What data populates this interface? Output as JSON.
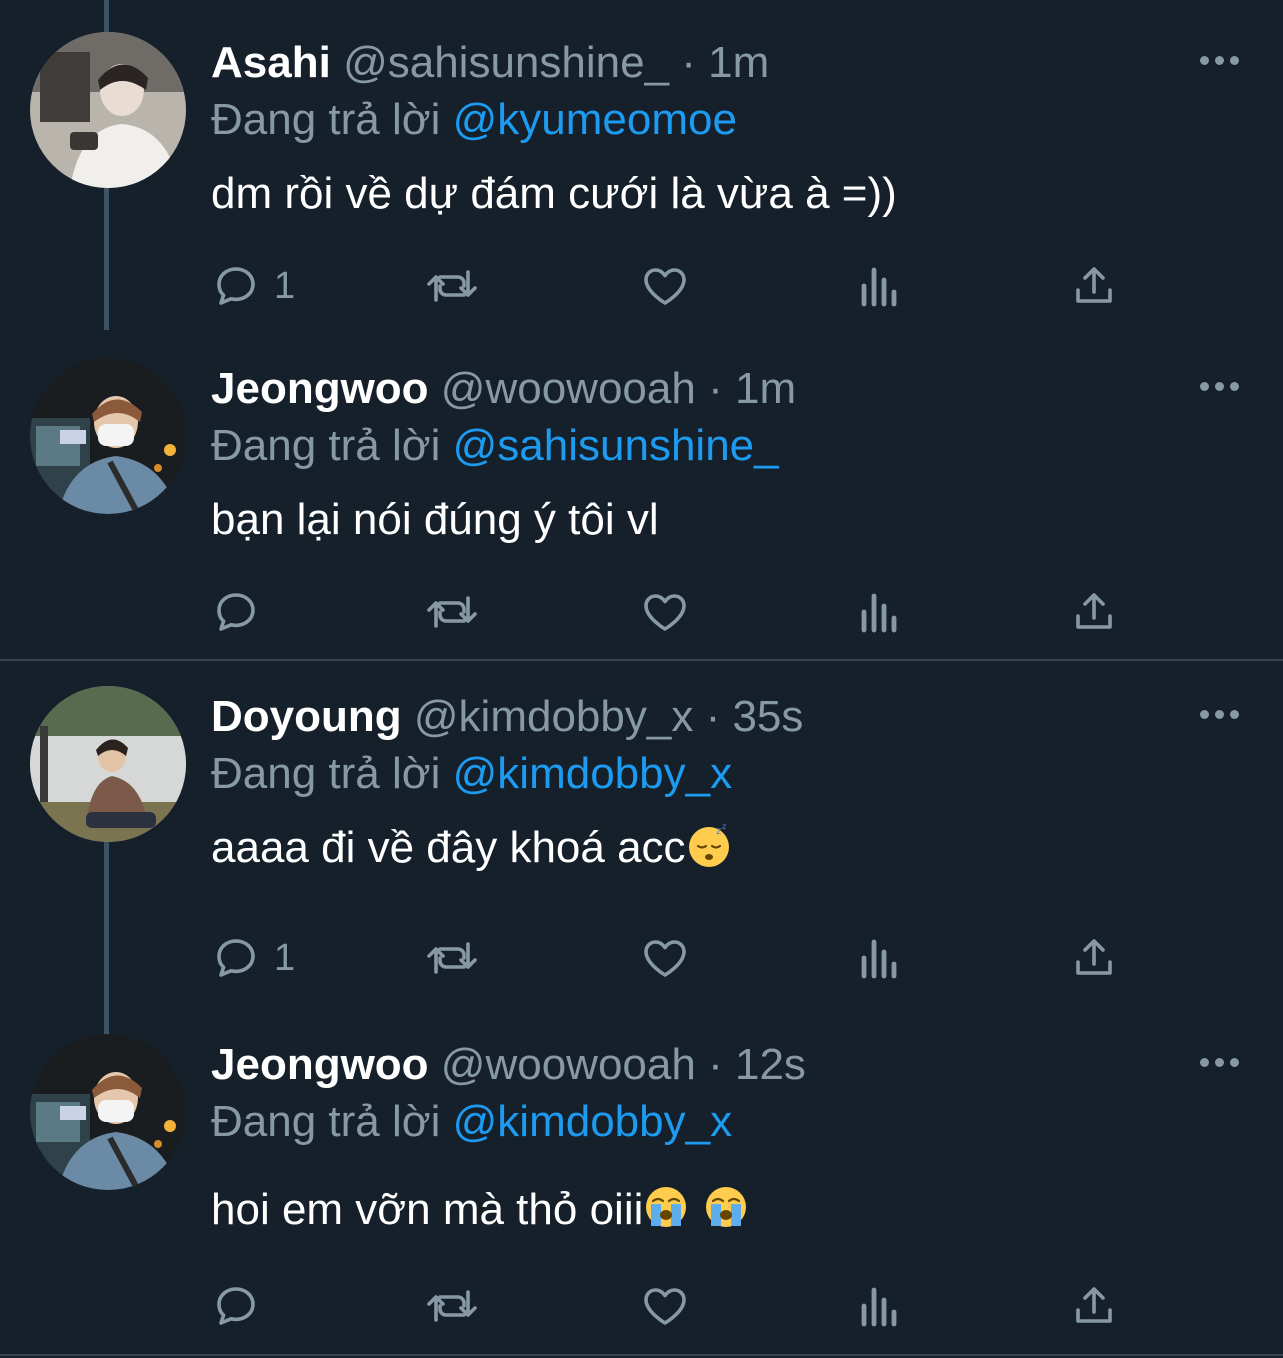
{
  "tweets": [
    {
      "display_name": "Asahi",
      "handle": "@sahisunshine_",
      "separator": "·",
      "time": "1m",
      "reply_prefix": "Đang trả lời",
      "reply_to": "@kyumeomoe",
      "text": "dm rồi về dự đám cưới là vừa à =))",
      "emoji": [],
      "reply_count": "1",
      "avatar_icon": "avatar-asahi"
    },
    {
      "display_name": "Jeongwoo",
      "handle": "@woowooah",
      "separator": "·",
      "time": "1m",
      "reply_prefix": "Đang trả lời",
      "reply_to": "@sahisunshine_",
      "text": "bạn lại nói đúng ý tôi vl",
      "emoji": [],
      "reply_count": "",
      "avatar_icon": "avatar-jeongwoo"
    },
    {
      "display_name": "Doyoung",
      "handle": "@kimdobby_x",
      "separator": "·",
      "time": "35s",
      "reply_prefix": "Đang trả lời",
      "reply_to": "@kimdobby_x",
      "text": "aaaa đi về đây khoá acc",
      "emoji": [
        "sleeping-face"
      ],
      "reply_count": "1",
      "avatar_icon": "avatar-doyoung"
    },
    {
      "display_name": "Jeongwoo",
      "handle": "@woowooah",
      "separator": "·",
      "time": "12s",
      "reply_prefix": "Đang trả lời",
      "reply_to": "@kimdobby_x",
      "text": "hoi em vỡn mà thỏ oiii",
      "emoji": [
        "crying-face",
        "crying-face"
      ],
      "reply_count": "",
      "avatar_icon": "avatar-jeongwoo"
    }
  ],
  "icons": {
    "reply": "reply-icon",
    "retweet": "retweet-icon",
    "like": "like-icon",
    "views": "views-icon",
    "share": "share-icon",
    "more": "more-icon"
  },
  "colors": {
    "background": "#15202b",
    "secondary_text": "#8899a6",
    "mention": "#1d9bf0",
    "thread_line": "#3d5466",
    "divider": "#38444d"
  }
}
